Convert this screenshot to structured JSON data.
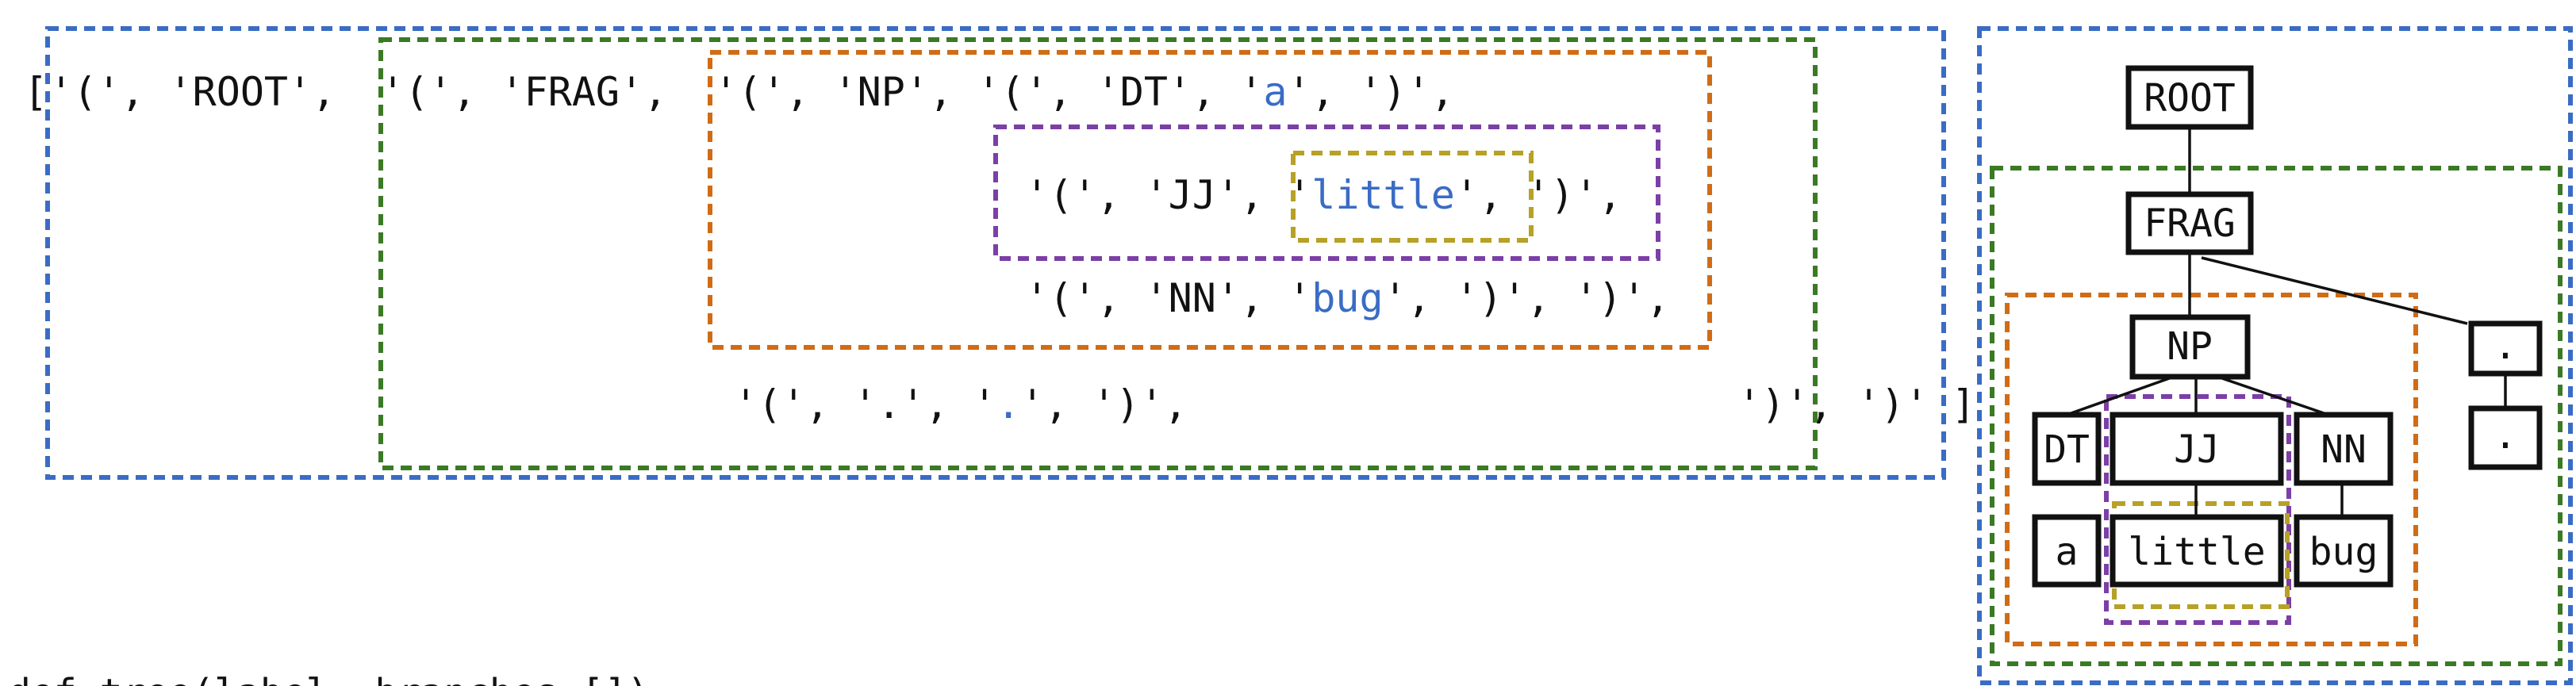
{
  "colors": {
    "blue": "#3a6cc4",
    "green": "#3b7a25",
    "orange": "#d06c16",
    "purple": "#7b3fa6",
    "olive": "#b7a126",
    "token_highlight": "#3a6cc4",
    "text": "#111111"
  },
  "sequence": {
    "open_bracket": "[",
    "close_bracket": "]",
    "line1": {
      "root_open": "'(', 'ROOT',",
      "frag_open": "'(', 'FRAG',",
      "np_open": "'(', 'NP', '(', 'DT', '",
      "tok_a": "a",
      "after_a": "', ')',"
    },
    "line2": {
      "jj_open": "'(', 'JJ', '",
      "tok_little": "little",
      "after_little": "', ')',"
    },
    "line3": {
      "nn_open": "'(', 'NN', '",
      "tok_bug": "bug",
      "after_bug": "', ')', ')',"
    },
    "line4": {
      "punct_open": "'(', '.', '",
      "tok_dot": ".",
      "after_dot": "', ')',",
      "closers": "')', ')'"
    }
  },
  "tree": {
    "ROOT": "ROOT",
    "FRAG": "FRAG",
    "NP": "NP",
    "punct": ".",
    "DT": "DT",
    "JJ": "JJ",
    "NN": "NN",
    "punct_leaf": ".",
    "a": "a",
    "little": "little",
    "bug": "bug"
  },
  "footer_fragment": "def tree(label, branches=[]):"
}
